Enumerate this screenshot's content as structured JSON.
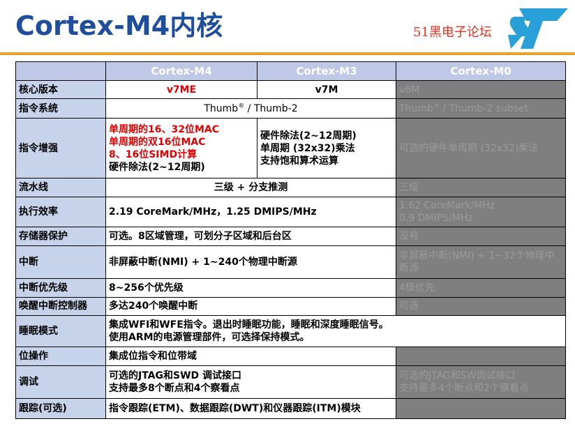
{
  "header": {
    "title": "Cortex-M4内核",
    "forum": "51黑电子论坛"
  },
  "table": {
    "columns": [
      "",
      "Cortex-M4",
      "Cortex-M3",
      "Cortex-M0"
    ],
    "rows": {
      "core": {
        "label": "核心版本",
        "m4": "v7ME",
        "m3": "v7M",
        "m0": "v6M"
      },
      "isa": {
        "label": "指令系统",
        "m4m3_a": "Thumb",
        "m4m3_b": " / Thumb-2",
        "m0_a": "Thumb",
        "m0_b": " / Thumb-2 subset",
        "reg": "®"
      },
      "enh": {
        "label": "指令增强",
        "m4": [
          "单周期的16、32位MAC",
          "单周期的双16位MAC",
          "8、16位SIMD计算",
          "硬件除法(2~12周期)"
        ],
        "m3": [
          "硬件除法(2~12周期)",
          "单周期 (32x32)乘法",
          "支持饱和算术运算"
        ],
        "m0": "可选的硬件单周期 (32x32)乘法"
      },
      "pipe": {
        "label": "流水线",
        "m4m3": "三级 + 分支推测",
        "m0": "三级"
      },
      "perf": {
        "label": "执行效率",
        "m4m3": "2.19 CoreMark/MHz，1.25 DMIPS/MHz",
        "m0": [
          "1.62 CoreMark/MHz",
          "0.9 DMIPS/MHz"
        ]
      },
      "mpu": {
        "label": "存储器保护",
        "m4m3": "可选。8区域管理，可划分子区域和后台区",
        "m0": "没有"
      },
      "irq": {
        "label": "中断",
        "m4m3": "非屏蔽中断(NMI) + 1~240个物理中断源",
        "m0": "非屏蔽中断(NMI) + 1~32个物理中断源"
      },
      "prio": {
        "label": "中断优先级",
        "m4m3": "8~256个优先级",
        "m0": "4级优先"
      },
      "wic": {
        "label": "唤醒中断控制器",
        "m4m3": "多达240个唤醒中断",
        "m0": "可选"
      },
      "sleep": {
        "label": "睡眠模式",
        "all": [
          "集成WFI和WFE指令。退出时睡眠功能，睡眠和深度睡眠信号。",
          "使用ARM的电源管理部件，可选择保持模式。"
        ]
      },
      "bit": {
        "label": "位操作",
        "m4m3": "集成位指令和位带域",
        "m0": ""
      },
      "debug": {
        "label": "调试",
        "m4m3": [
          "可选的JTAG和SWD 调试接口",
          "支持最多8个断点和4个察看点"
        ],
        "m0": [
          "可选的JTAG和SW调试接口",
          "支持最多4个断点和2个察看点"
        ]
      },
      "trace": {
        "label": "跟踪(可选)",
        "m4m3": "指令跟踪(ETM)、数据跟踪(DWT)和仪器跟踪(ITM)模块",
        "m0": ""
      }
    }
  },
  "colors": {
    "title": "#1f4e9c",
    "accent_rule": "#f0a020",
    "header_bg": "#bfc8e6",
    "label_bg": "#c7d3eb",
    "m0_bg": "#7f7f7f",
    "red": "#e00000"
  }
}
